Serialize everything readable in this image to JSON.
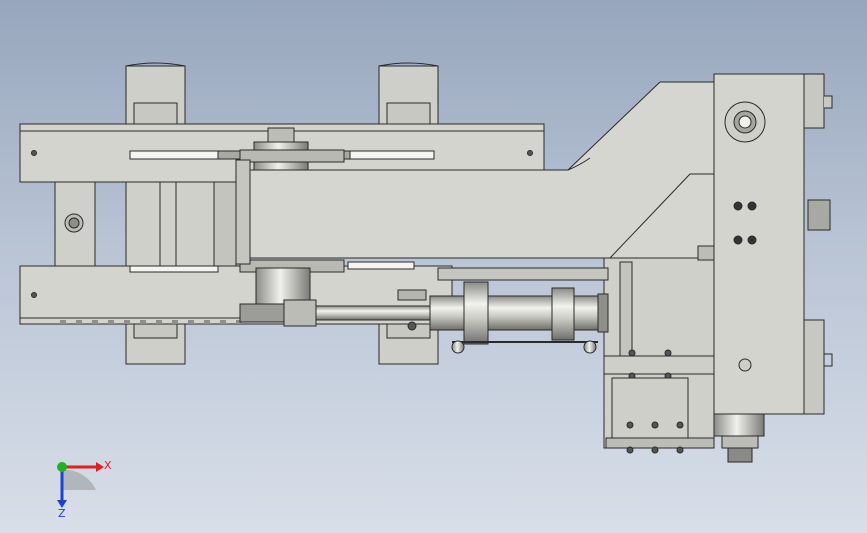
{
  "viewport": {
    "background_top": "#97a6bd",
    "background_bottom": "#d8dfe9"
  },
  "triad": {
    "x_label": "X",
    "z_label": "Z",
    "x_color": "#e02020",
    "y_color": "#20b020",
    "z_color": "#2040d0"
  },
  "model": {
    "part_color": "#d4d4cf",
    "edge_color": "#2a2a2a",
    "shadow_color": "#a9a9a3",
    "slot_color": "#f4f4f2"
  }
}
